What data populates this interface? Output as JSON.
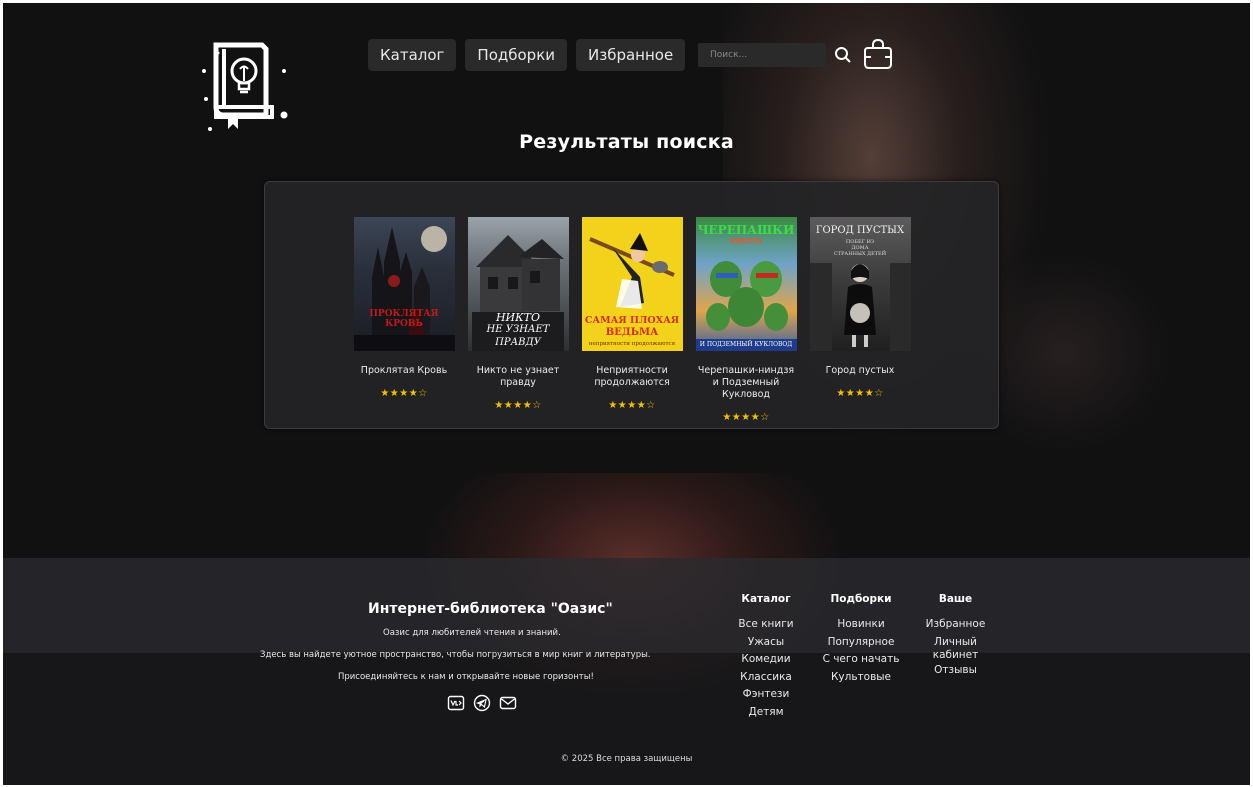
{
  "header": {
    "nav": [
      {
        "label": "Каталог"
      },
      {
        "label": "Подборки"
      },
      {
        "label": "Избранное"
      }
    ],
    "search": {
      "placeholder": "Поиск..."
    }
  },
  "main": {
    "heading": "Результаты поиска",
    "results": [
      {
        "title": "Проклятая Кровь",
        "rating": "★★★★☆",
        "cover_text": "ПРОКЛЯТАЯ КРОВЬ"
      },
      {
        "title": "Никто не узнает правду",
        "rating": "★★★★☆",
        "cover_text": [
          "НИКТО",
          "НЕ УЗНАЕТ",
          "ПРАВДУ"
        ]
      },
      {
        "title": "Неприятности продолжаются",
        "rating": "★★★★☆",
        "cover_text": [
          "САМАЯ ПЛОХАЯ",
          "ВЕДЬМА",
          "неприятности продолжаются"
        ]
      },
      {
        "title": "Черепашки-ниндзя и Подземный Кукловод",
        "rating": "★★★★☆",
        "cover_text": [
          "ЧЕРЕПАШКИ",
          "НИНДЗЯ",
          "И ПОДЗЕМНЫЙ КУКЛОВОД"
        ]
      },
      {
        "title": "Город пустых",
        "rating": "★★★★☆",
        "cover_text": [
          "ГОРОД ПУСТЫХ",
          "ПОБЕГ ИЗ",
          "ДОМА",
          "СТРАННЫХ ДЕТЕЙ"
        ]
      }
    ]
  },
  "footer": {
    "title": "Интернет-библиотека \"Оазис\"",
    "lines": [
      "Оазис для любителей чтения и знаний.",
      "Здесь вы найдете уютное пространство, чтобы погрузиться в мир книг и литературы.",
      "Присоединяйтесь к нам и открывайте новые горизонты!"
    ],
    "columns": [
      {
        "heading": "Каталог",
        "items": [
          "Все книги",
          "Ужасы",
          "Комедии",
          "Классика",
          "Фэнтези",
          "Детям"
        ]
      },
      {
        "heading": "Подборки",
        "items": [
          "Новинки",
          "Популярное",
          "С чего начать",
          "Культовые"
        ]
      },
      {
        "heading": "Ваше",
        "items": [
          "Избранное",
          "Личный",
          "кабинет",
          "Отзывы"
        ]
      }
    ],
    "copyright": "© 2025 Все права защищены"
  }
}
